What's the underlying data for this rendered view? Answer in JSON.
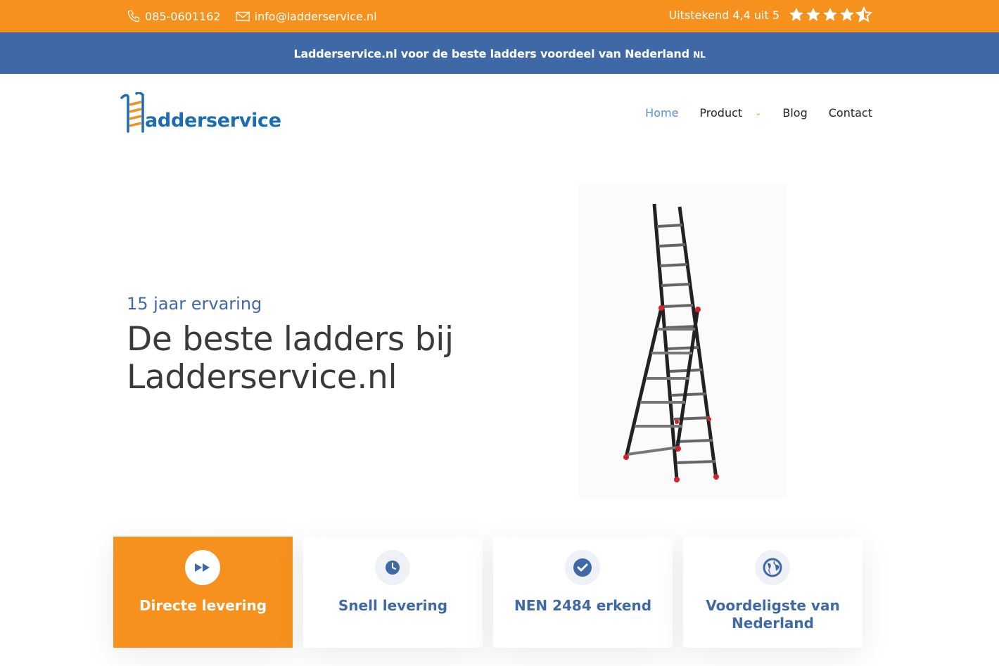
{
  "topbar": {
    "phone": "085-0601162",
    "email": "info@ladderservice.nl",
    "rating_text": "Uitstekend 4,4 uit 5",
    "rating_value": 4.5,
    "rating_max": 5
  },
  "promo": {
    "text": "Ladderservice.nl voor de beste ladders voordeel  van Nederland",
    "suffix": "NL"
  },
  "header": {
    "logo_text": "adderservice",
    "nav": [
      {
        "label": "Home",
        "active": true
      },
      {
        "label": "Product",
        "active": false
      },
      {
        "label": "Blog",
        "active": false
      },
      {
        "label": "Contact",
        "active": false
      }
    ]
  },
  "hero": {
    "subtitle": "15 jaar ervaring",
    "title_line1": "De beste ladders bij",
    "title_line2": "Ladderservice.nl"
  },
  "features": [
    {
      "label": "Directe levering",
      "icon": "fast-forward-icon",
      "active": true
    },
    {
      "label": "Snell levering",
      "icon": "clock-icon",
      "active": false
    },
    {
      "label": "NEN 2484 erkend",
      "icon": "check-circle-icon",
      "active": false
    },
    {
      "label": "Voordeligste van Nederland",
      "icon": "globe-icon",
      "active": false
    }
  ],
  "colors": {
    "orange": "#F6911E",
    "blue": "#3F69A6",
    "logo_blue": "#1C6EB4",
    "nav_active": "#5B8FC9"
  }
}
